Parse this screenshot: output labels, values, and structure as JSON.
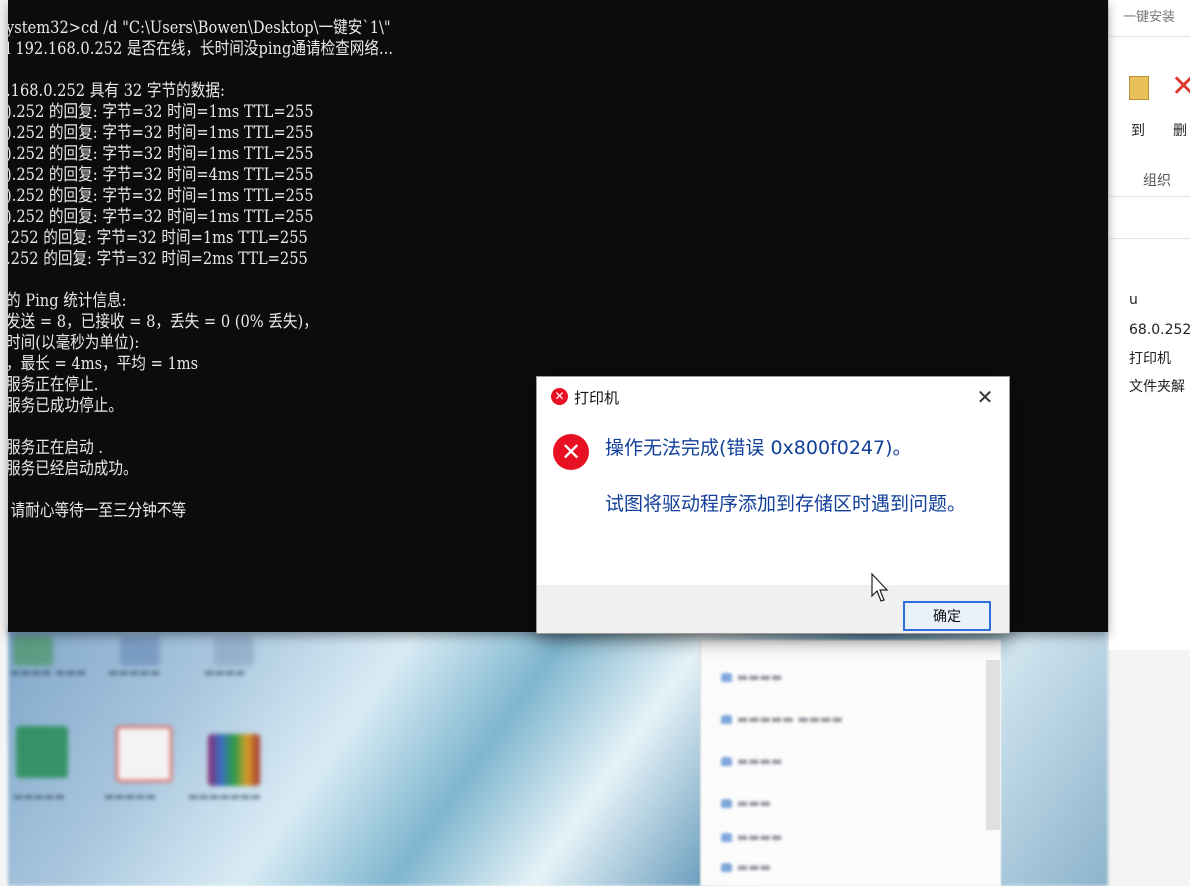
{
  "console": {
    "lines": [
      "ystem32>cd /d \"C:\\Users\\Bowen\\Desktop\\一键安`1\\\"",
      "l 192.168.0.252 是否在线，长时间没ping通请检查网络...",
      "",
      ".168.0.252 具有 32 字节的数据:",
      ").252 的回复: 字节=32 时间=1ms TTL=255",
      ").252 的回复: 字节=32 时间=1ms TTL=255",
      ").252 的回复: 字节=32 时间=1ms TTL=255",
      ").252 的回复: 字节=32 时间=4ms TTL=255",
      ").252 的回复: 字节=32 时间=1ms TTL=255",
      ").252 的回复: 字节=32 时间=1ms TTL=255",
      ".252 的回复: 字节=32 时间=1ms TTL=255",
      ".252 的回复: 字节=32 时间=2ms TTL=255",
      "",
      "的 Ping 统计信息:",
      "发送 = 8，已接收 = 8，丢失 = 0 (0% 丢失)，",
      "时间(以毫秒为单位):",
      "，最长 = 4ms，平均 = 1ms",
      "服务正在停止.",
      "服务已成功停止。",
      "",
      "服务正在启动 .",
      "服务已经启动成功。",
      "",
      " 请耐心等待一至三分钟不等"
    ]
  },
  "dialog": {
    "title": "打印机",
    "close_glyph": "✕",
    "title_icon": "error-icon",
    "heading": "操作无法完成(错误 0x800f0247)。",
    "detail": "试图将驱动程序添加到存储区时遇到问题。",
    "ok_label": "确定",
    "error_glyph": "✕",
    "accent_color": "#e81123",
    "text_color": "#123f9a"
  },
  "explorer_right": {
    "top_label": "一键安装",
    "btn_to": "到",
    "btn_delete": "删",
    "group_label": "组织",
    "path_u": "u",
    "path_ip": "68.0.252",
    "item_printer": "打印机",
    "item_folder": "文件夹解"
  }
}
